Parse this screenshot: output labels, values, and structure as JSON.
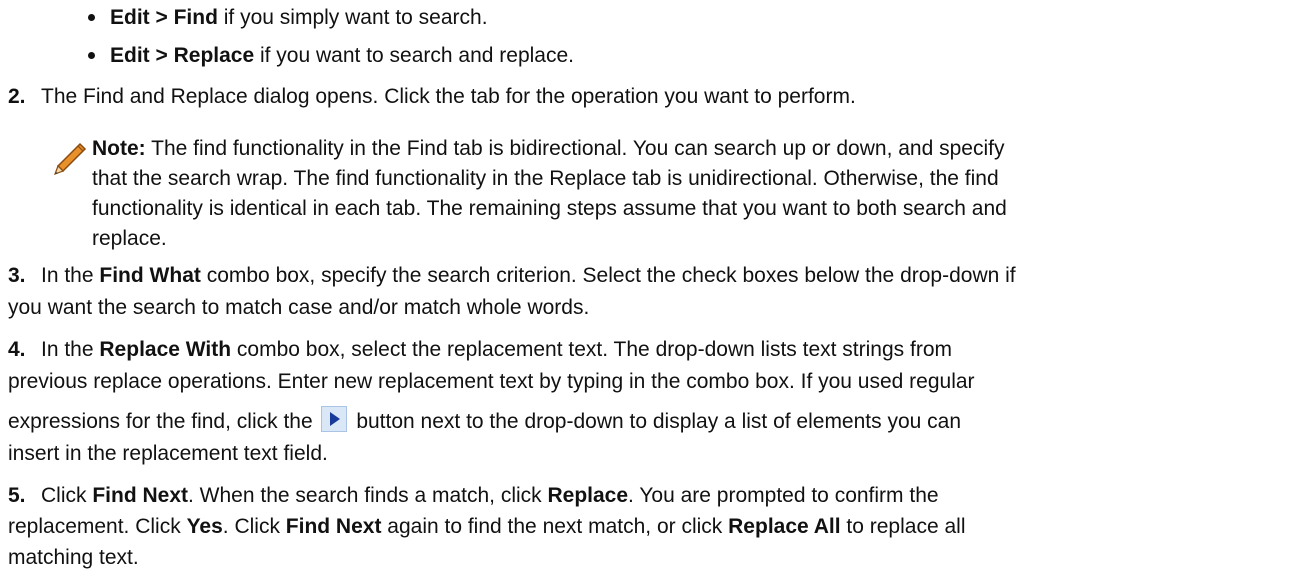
{
  "bullets": [
    {
      "bold": "Edit > Find",
      "rest": " if you simply want to search."
    },
    {
      "bold": "Edit > Replace",
      "rest": " if you want to search and replace."
    }
  ],
  "step2": {
    "num": "2.",
    "text": "The Find and Replace dialog opens. Click the tab for the operation you want to perform."
  },
  "note": {
    "label": "Note:",
    "line1": " The find functionality in the Find tab is bidirectional. You can search up or down, and specify",
    "line2": "that the search wrap. The find functionality in the Replace tab is unidirectional. Otherwise, the find",
    "line3": "functionality is identical in each tab. The remaining steps assume that you want to both search and",
    "line4": "replace."
  },
  "step3": {
    "num": "3.",
    "a": "In the ",
    "b": "Find What",
    "c": " combo box, specify the search criterion. Select the check boxes below the drop-down if",
    "line2": "you want the search to match case and/or match whole words."
  },
  "step4": {
    "num": "4.",
    "a": "In the ",
    "b": "Replace With",
    "c": " combo box, select the replacement text. The drop-down lists text strings from",
    "line2": "previous replace operations. Enter new replacement text by typing in the combo box. If you used regular",
    "line3a": "expressions for the find, click the ",
    "line3b": " button next to the drop-down to display a list of elements you can",
    "line4": "insert in the replacement text field."
  },
  "step5": {
    "num": "5.",
    "l1a": "Click ",
    "l1b": "Find Next",
    "l1c": ". When the search finds a match, click ",
    "l1d": "Replace",
    "l1e": ". You are prompted to confirm the",
    "l2a": "replacement. Click ",
    "l2b": "Yes",
    "l2c": ". Click ",
    "l2d": "Find Next",
    "l2e": " again to find the next match, or click ",
    "l2f": "Replace All",
    "l2g": " to replace all",
    "l3": "matching text."
  },
  "icons": {
    "note": "pencil-icon",
    "inline_button": "play-arrow-icon"
  },
  "colors": {
    "text": "#111111",
    "pencil": "#e8902a",
    "arrow": "#1a3a9a"
  }
}
